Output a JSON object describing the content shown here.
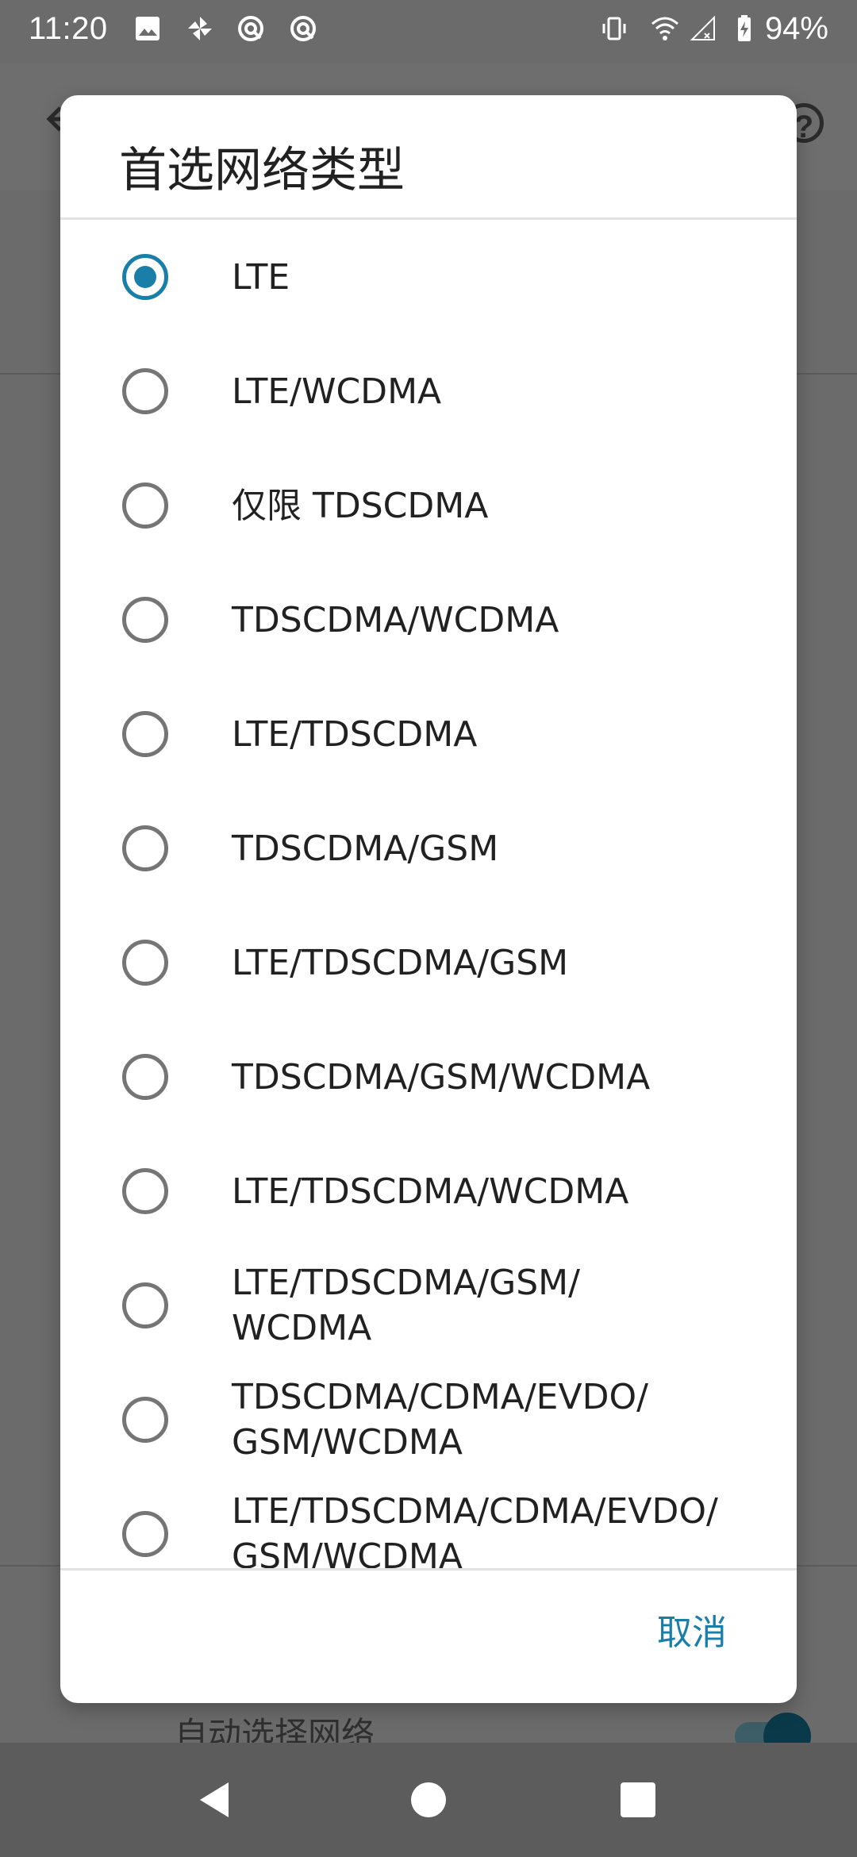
{
  "status_bar": {
    "time": "11:20",
    "battery_percent": "94%",
    "left_icons": [
      "image-icon",
      "pinwheel-icon",
      "vpn-key-icon",
      "vpn-key-icon"
    ],
    "right_icons": [
      "vibrate-icon",
      "wifi-icon",
      "signal-icon",
      "battery-charging-icon"
    ]
  },
  "background": {
    "auto_select_label": "自动选择网络",
    "toggle_on": true
  },
  "dialog": {
    "title": "首选网络类型",
    "selected_index": 0,
    "accent_color": "#1a7fa8",
    "options": [
      {
        "label": "LTE",
        "checked": true
      },
      {
        "label": "LTE/WCDMA",
        "checked": false
      },
      {
        "label": "仅限 TDSCDMA",
        "checked": false
      },
      {
        "label": "TDSCDMA/WCDMA",
        "checked": false
      },
      {
        "label": "LTE/TDSCDMA",
        "checked": false
      },
      {
        "label": "TDSCDMA/GSM",
        "checked": false
      },
      {
        "label": "LTE/TDSCDMA/GSM",
        "checked": false
      },
      {
        "label": "TDSCDMA/GSM/WCDMA",
        "checked": false
      },
      {
        "label": "LTE/TDSCDMA/WCDMA",
        "checked": false
      },
      {
        "label": "LTE/TDSCDMA/GSM/\nWCDMA",
        "checked": false
      },
      {
        "label": "TDSCDMA/CDMA/EVDO/\nGSM/WCDMA",
        "checked": false
      },
      {
        "label": "LTE/TDSCDMA/CDMA/EVDO/\nGSM/WCDMA",
        "checked": false
      }
    ],
    "cancel_label": "取消"
  },
  "nav_bar": {
    "buttons": [
      "back-icon",
      "home-icon",
      "recents-icon"
    ]
  }
}
